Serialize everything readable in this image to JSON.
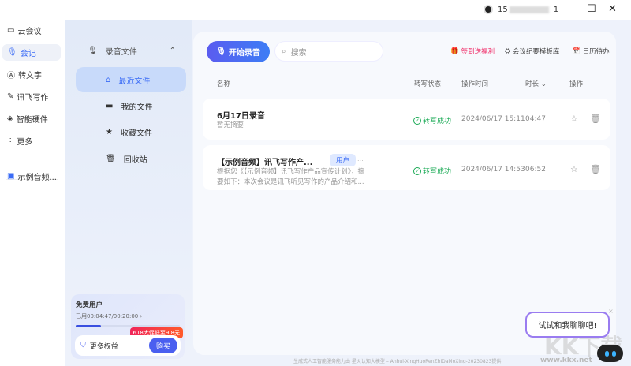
{
  "titlebar": {
    "user": "15",
    "user_suffix": "1",
    "minimize": "—",
    "maximize": "☐",
    "close": "✕"
  },
  "nav": {
    "items": [
      {
        "label": "云会议",
        "icon": "video-icon"
      },
      {
        "label": "会记",
        "icon": "mic-icon"
      },
      {
        "label": "转文字",
        "icon": "text-convert-icon"
      },
      {
        "label": "讯飞写作",
        "icon": "write-icon"
      },
      {
        "label": "智能硬件",
        "icon": "hardware-icon"
      },
      {
        "label": "更多",
        "icon": "grid-icon"
      }
    ],
    "recent": "示例音频..."
  },
  "sidebar": {
    "header": "录音文件",
    "items": [
      "最近文件",
      "我的文件",
      "收藏文件",
      "回收站"
    ],
    "quota": {
      "title": "免费用户",
      "used": "已用00:04:47/00:20:00 ›",
      "progress": 0.24,
      "promo": "618大促低至9.8元",
      "more": "更多权益",
      "buy": "购买"
    }
  },
  "toolbar": {
    "record": "开始录音",
    "search_placeholder": "搜索",
    "checkin": "签到送福利",
    "templates": "会议纪要模板库",
    "calendar": "日历待办"
  },
  "table": {
    "headers": [
      "名称",
      "转写状态",
      "操作时间",
      "时长 ⌄",
      "操作"
    ],
    "rows": [
      {
        "title": "6月17日录音",
        "summary": "暂无摘要",
        "status": "转写成功",
        "time": "2024/06/17 15:11",
        "duration": "04:47"
      },
      {
        "title": "【示例音频】讯飞写作产...",
        "tag": "用户",
        "more": "...",
        "summary": "根据您《【示例音频】讯飞写作产品宣传计划》，摘要如下：本次会议是讯飞听见写作的产品介绍和...",
        "status": "转写成功",
        "time": "2024/06/17 14:53",
        "duration": "06:52"
      }
    ]
  },
  "footer": "生成式人工智能服务能力由 星火认知大模型 – Anhui-XingHuoRenZhiDaMoXing-20230823提供",
  "chat": {
    "bubble": "试试和我聊聊吧!",
    "close": "×"
  },
  "watermark": {
    "text": "KK下载",
    "url": "www.kkx.net"
  }
}
